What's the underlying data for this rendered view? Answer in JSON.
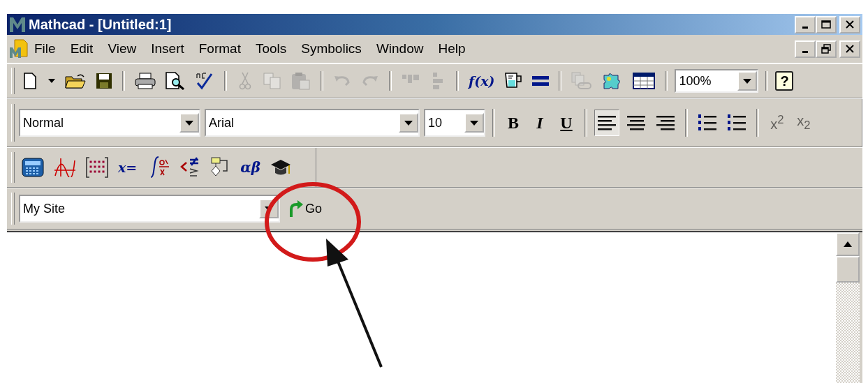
{
  "window": {
    "title": "Mathcad - [Untitled:1]"
  },
  "menu_bar": {
    "items": [
      "File",
      "Edit",
      "View",
      "Insert",
      "Format",
      "Tools",
      "Symbolics",
      "Window",
      "Help"
    ]
  },
  "standard_toolbar": {
    "groups": [
      [
        {
          "kind": "new",
          "disabled": false
        },
        {
          "kind": "dropdown",
          "disabled": false
        },
        {
          "kind": "open",
          "disabled": false
        },
        {
          "kind": "save",
          "disabled": false
        }
      ],
      [
        {
          "kind": "print",
          "disabled": false
        },
        {
          "kind": "preview",
          "disabled": false
        },
        {
          "kind": "spell",
          "disabled": false
        }
      ],
      [
        {
          "kind": "cut",
          "disabled": true
        },
        {
          "kind": "copy",
          "disabled": true
        },
        {
          "kind": "paste",
          "disabled": true
        }
      ],
      [
        {
          "kind": "undo",
          "disabled": true
        },
        {
          "kind": "redo",
          "disabled": true
        }
      ],
      [
        {
          "kind": "align-top",
          "disabled": true
        },
        {
          "kind": "align-left",
          "disabled": true
        }
      ],
      [
        {
          "kind": "function",
          "label": "f(x)",
          "disabled": false
        },
        {
          "kind": "units",
          "disabled": false
        },
        {
          "kind": "equals",
          "disabled": false
        }
      ],
      [
        {
          "kind": "link",
          "disabled": true
        },
        {
          "kind": "component",
          "disabled": false
        },
        {
          "kind": "table",
          "disabled": false
        }
      ]
    ],
    "zoom": "100%",
    "help": "?"
  },
  "format_toolbar": {
    "style": "Normal",
    "font": "Arial",
    "size": "10",
    "groups": [
      [
        {
          "kind": "bold",
          "label": "B",
          "selected": false,
          "disabled": false
        },
        {
          "kind": "italic",
          "label": "I",
          "selected": false,
          "disabled": false
        },
        {
          "kind": "underline",
          "label": "U",
          "selected": false,
          "disabled": false
        }
      ],
      [
        {
          "kind": "align-left",
          "selected": true,
          "disabled": false
        },
        {
          "kind": "align-center",
          "selected": false,
          "disabled": false
        },
        {
          "kind": "align-right",
          "selected": false,
          "disabled": false
        }
      ],
      [
        {
          "kind": "bullets",
          "selected": false,
          "disabled": false
        },
        {
          "kind": "numbering",
          "selected": false,
          "disabled": false
        }
      ],
      [
        {
          "kind": "superscript",
          "label": "x$^{2}$",
          "selected": false,
          "disabled": true
        },
        {
          "kind": "subscript",
          "label": "x$_{2}$",
          "selected": false,
          "disabled": true
        }
      ]
    ]
  },
  "math_toolbar": {
    "items": [
      {
        "kind": "calculator"
      },
      {
        "kind": "graph"
      },
      {
        "kind": "matrix"
      },
      {
        "kind": "evaluation",
        "label": "x="
      },
      {
        "kind": "calculus"
      },
      {
        "kind": "boolean"
      },
      {
        "kind": "programming"
      },
      {
        "kind": "greek",
        "label": "αβ"
      },
      {
        "kind": "symbolic"
      }
    ]
  },
  "url_bar": {
    "value": "My Site",
    "go": "Go"
  }
}
